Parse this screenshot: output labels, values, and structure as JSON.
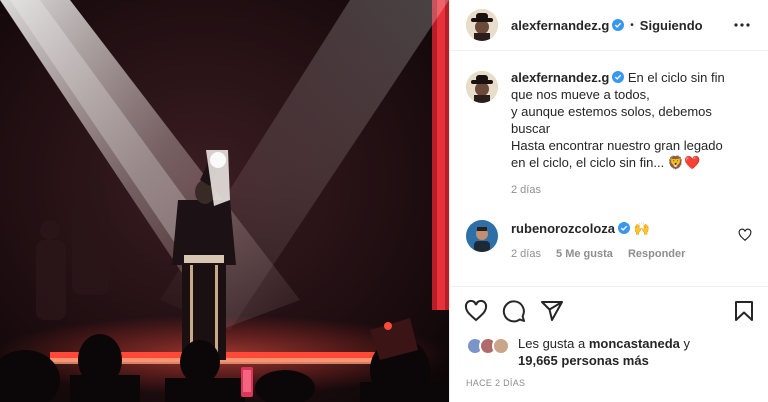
{
  "header": {
    "username": "alexfernandez.g",
    "separator": "•",
    "follow_status": "Siguiendo"
  },
  "caption": {
    "username": "alexfernandez.g",
    "lines": [
      "En el ciclo sin fin",
      "que nos mueve a todos,",
      "y aunque estemos solos, debemos",
      "buscar",
      "Hasta encontrar nuestro gran legado",
      "en el ciclo, el ciclo sin fin... 🦁❤️"
    ],
    "time": "2 días"
  },
  "comment": {
    "username": "rubenorozcoloza",
    "text": "🙌",
    "time": "2 días",
    "likes": "5 Me gusta",
    "reply_label": "Responder"
  },
  "likes": {
    "prefix": "Les gusta a",
    "first_user": "moncastaneda",
    "connector": "y",
    "others": "19,665 personas más"
  },
  "time_ago": "Hace 2 días",
  "icons": {
    "like": "heart-icon",
    "comment": "comment-icon",
    "share": "share-icon",
    "save": "bookmark-icon",
    "more": "more-icon",
    "verified": "verified-badge-icon"
  },
  "colors": {
    "verified": "#3897f0",
    "heart_red": "#ed4956",
    "stage_red": "#e8323a"
  }
}
